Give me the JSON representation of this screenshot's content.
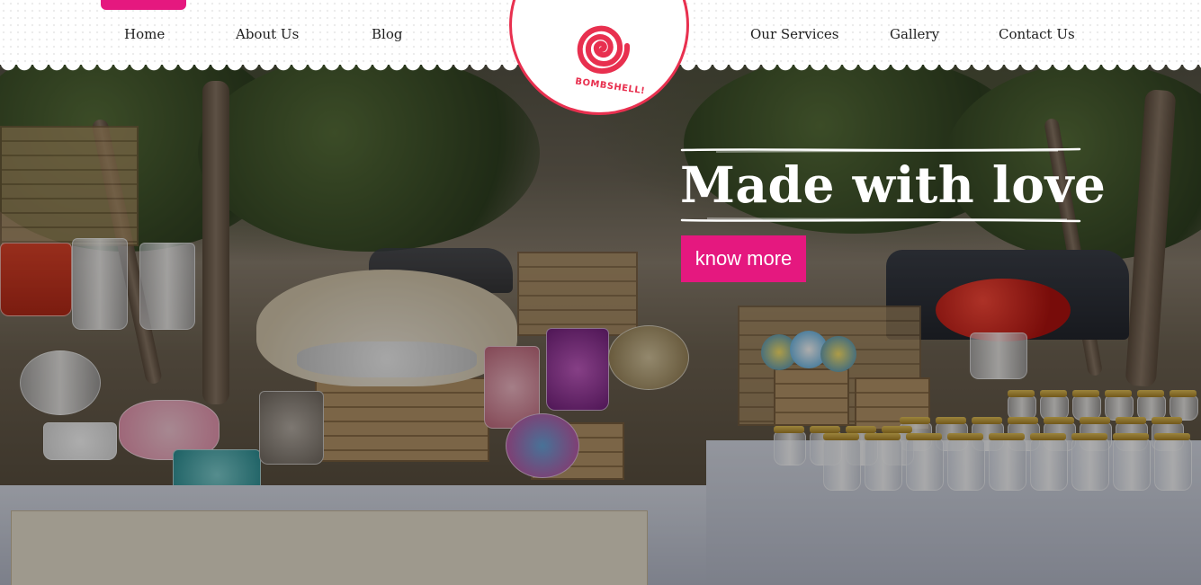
{
  "brand": {
    "logo_text": "BOMBSHELL!",
    "primary_color": "#e5187f",
    "logo_color": "#e8304f"
  },
  "nav": {
    "left": [
      {
        "label": "Home"
      },
      {
        "label": "About Us"
      },
      {
        "label": "Blog"
      }
    ],
    "right": [
      {
        "label": "Our Services"
      },
      {
        "label": "Gallery"
      },
      {
        "label": "Contact Us"
      }
    ]
  },
  "hero": {
    "title": "Made with love",
    "cta_label": "know more",
    "background": "candy-buffet-photo"
  }
}
